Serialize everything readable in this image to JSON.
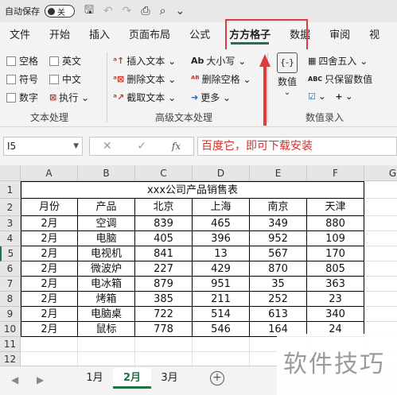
{
  "titlebar": {
    "autosave_label": "自动保存",
    "toggle_label": "关",
    "more": "⌄"
  },
  "tabs": [
    "文件",
    "开始",
    "插入",
    "页面布局",
    "公式",
    "方方格子",
    "数据",
    "审阅",
    "视"
  ],
  "active_tab": "方方格子",
  "ribbon": {
    "text_group": {
      "checkboxes": [
        "空格",
        "英文",
        "符号",
        "中文",
        "数字"
      ],
      "execute_label": "执行",
      "label": "文本处理"
    },
    "advanced_group": {
      "insert_text": "插入文本",
      "delete_text": "删除文本",
      "extract_text": "截取文本",
      "case": "大小写",
      "delete_space": "删除空格",
      "more": "更多",
      "label": "高级文本处理"
    },
    "number_group": {
      "value_label": "数值",
      "round": "四舍五入",
      "keep_values": "只保留数值",
      "label": "数值录入"
    }
  },
  "formula_bar": {
    "name_box": "I5",
    "fx": "fx",
    "content": "百度它，即可下载安装"
  },
  "columns": [
    "A",
    "B",
    "C",
    "D",
    "E",
    "F",
    "G"
  ],
  "rows": [
    "1",
    "2",
    "3",
    "4",
    "5",
    "6",
    "7",
    "8",
    "9",
    "10",
    "11",
    "12"
  ],
  "table": {
    "title": "xxx公司产品销售表",
    "headers": [
      "月份",
      "产品",
      "北京",
      "上海",
      "南京",
      "天津"
    ],
    "rows": [
      [
        "2月",
        "空调",
        "839",
        "465",
        "349",
        "880"
      ],
      [
        "2月",
        "电脑",
        "405",
        "396",
        "952",
        "109"
      ],
      [
        "2月",
        "电视机",
        "841",
        "13",
        "567",
        "170"
      ],
      [
        "2月",
        "微波炉",
        "227",
        "429",
        "870",
        "805"
      ],
      [
        "2月",
        "电冰箱",
        "879",
        "951",
        "35",
        "363"
      ],
      [
        "2月",
        "烤箱",
        "385",
        "211",
        "252",
        "23"
      ],
      [
        "2月",
        "电脑桌",
        "722",
        "514",
        "613",
        "340"
      ],
      [
        "2月",
        "鼠标",
        "778",
        "546",
        "164",
        "24"
      ]
    ]
  },
  "sheets": [
    "1月",
    "2月",
    "3月"
  ],
  "active_sheet": "2月",
  "watermark": "软件技巧",
  "colors": {
    "accent": "#217346",
    "highlight": "#e03a3a",
    "formula_text": "#d0312d"
  }
}
